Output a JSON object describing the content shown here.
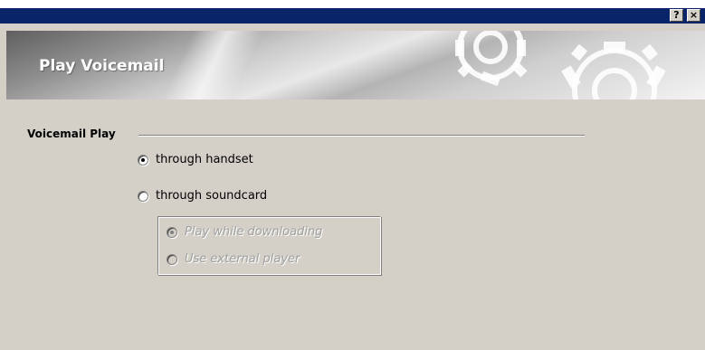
{
  "window": {
    "help_label": "?",
    "close_label": "×"
  },
  "banner": {
    "title": "Play Voicemail",
    "graphic": "gears-icon"
  },
  "group": {
    "label": "Voicemail Play"
  },
  "options": {
    "handset": {
      "label": "through handset",
      "checked": true,
      "enabled": true
    },
    "soundcard": {
      "label": "through soundcard",
      "checked": false,
      "enabled": true
    }
  },
  "sub_options": {
    "play_while_downloading": {
      "label": "Play while downloading",
      "checked": true,
      "enabled": false
    },
    "use_external_player": {
      "label": "Use external player",
      "checked": false,
      "enabled": false
    }
  },
  "colors": {
    "titlebar": "#0a246a",
    "face": "#d4d0c8"
  }
}
